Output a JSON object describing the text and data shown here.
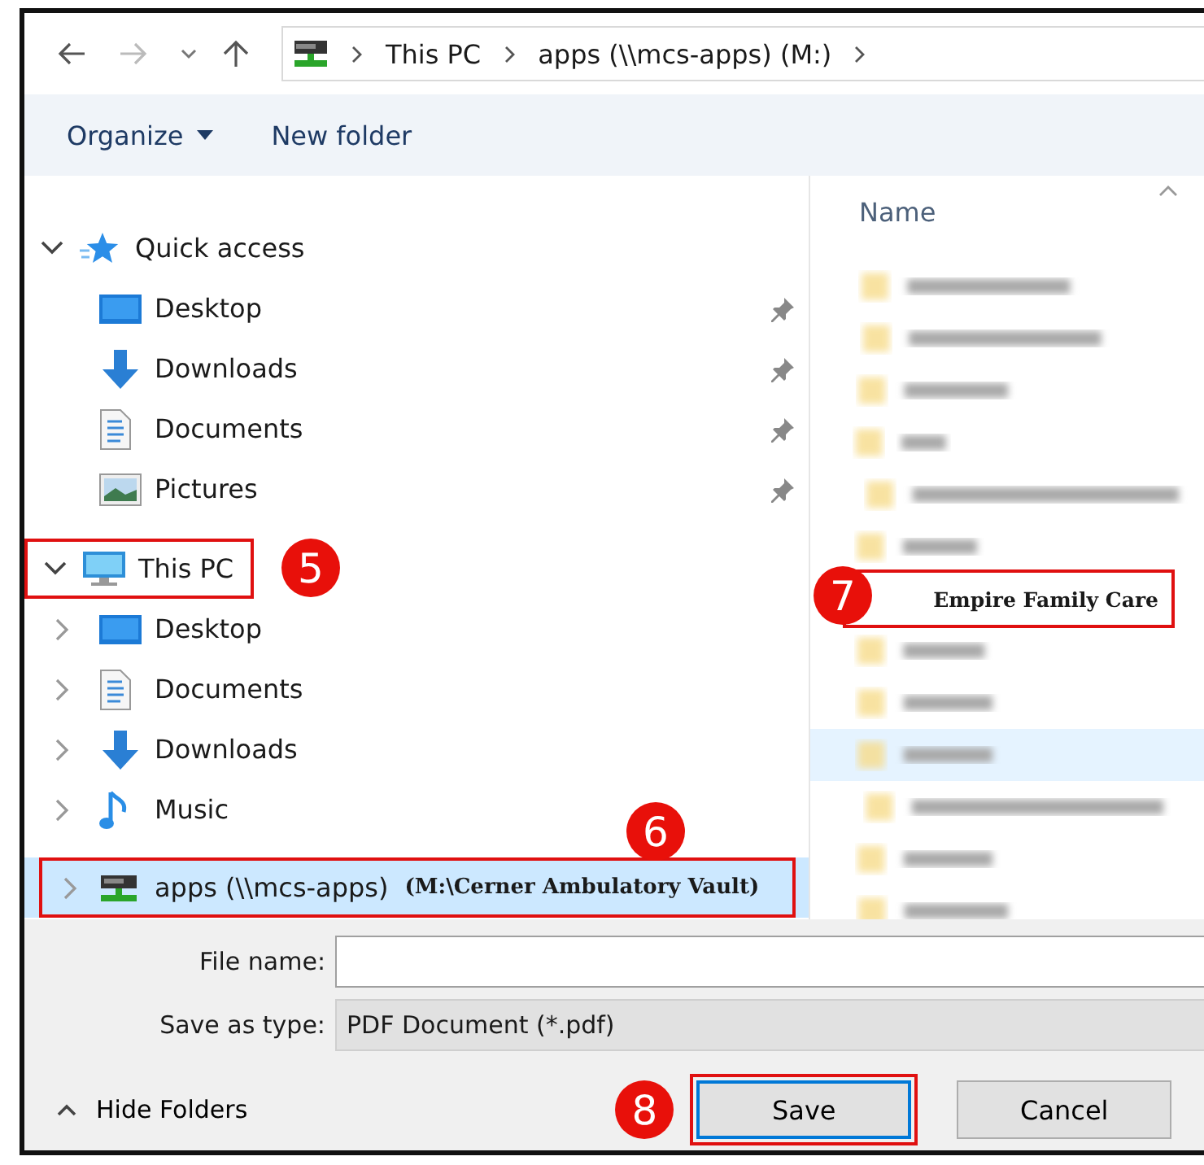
{
  "address_bar": {
    "path": [
      "This PC",
      "apps (\\\\mcs-apps) (M:)"
    ]
  },
  "toolbar": [
    {
      "label": "Organize",
      "dropdown": true
    },
    {
      "label": "New folder",
      "dropdown": false
    }
  ],
  "nav_tree": [
    {
      "label": "Quick access",
      "kind": "star",
      "expanded": true,
      "selected": false,
      "children": [
        {
          "label": "Desktop",
          "kind": "desktop",
          "pinned": true,
          "selected": false
        },
        {
          "label": "Downloads",
          "kind": "download",
          "pinned": true,
          "selected": false
        },
        {
          "label": "Documents",
          "kind": "document",
          "pinned": true,
          "selected": false
        },
        {
          "label": "Pictures",
          "kind": "picture",
          "pinned": true,
          "selected": false
        }
      ]
    },
    {
      "label": "This PC",
      "kind": "pc",
      "expanded": true,
      "selected": false,
      "callout": "5",
      "children": [
        {
          "label": "Desktop",
          "kind": "desktop",
          "expanded": false,
          "selected": false
        },
        {
          "label": "Documents",
          "kind": "document",
          "expanded": false,
          "selected": false
        },
        {
          "label": "Downloads",
          "kind": "download",
          "expanded": false,
          "selected": false
        },
        {
          "label": "Music",
          "kind": "music",
          "expanded": false,
          "selected": false
        },
        {
          "label": "apps (\\\\mcs-apps)",
          "kind": "drive",
          "expanded": false,
          "selected": true,
          "note": "(M:\\Cerner Ambulatory Vault)",
          "callout": "6"
        }
      ]
    }
  ],
  "file_list": {
    "column": "Name",
    "rows": [
      {
        "kind": "blurred",
        "selected": false
      },
      {
        "kind": "blurred",
        "selected": false
      },
      {
        "kind": "blurred",
        "selected": false
      },
      {
        "kind": "blurred",
        "selected": false
      },
      {
        "kind": "blurred",
        "selected": false
      },
      {
        "kind": "blurred",
        "selected": false
      },
      {
        "kind": "named",
        "name": "Empire Family Care",
        "callout": "7",
        "selected": false
      },
      {
        "kind": "blurred",
        "selected": false
      },
      {
        "kind": "blurred",
        "selected": false
      },
      {
        "kind": "blurred",
        "selected": true
      },
      {
        "kind": "blurred",
        "selected": false
      },
      {
        "kind": "blurred",
        "selected": false
      },
      {
        "kind": "blurred",
        "selected": false
      }
    ]
  },
  "file_name": {
    "label": "File name:"
  },
  "save_type": {
    "label": "Save as type:",
    "value": "PDF Document (*.pdf)"
  },
  "hide_folders": "Hide Folders",
  "buttons": [
    {
      "label": "Save",
      "default": true,
      "callout": "8"
    },
    {
      "label": "Cancel",
      "default": false
    }
  ]
}
